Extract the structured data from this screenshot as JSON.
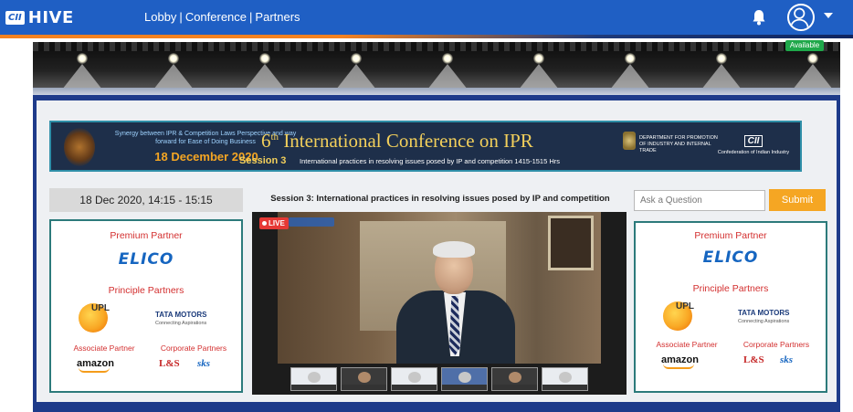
{
  "header": {
    "logo_cii": "CII",
    "logo_hive": "HIVE",
    "nav": [
      {
        "label": "Lobby"
      },
      {
        "label": "Conference"
      },
      {
        "label": "Partners"
      }
    ],
    "nav_separator": "|"
  },
  "stage": {
    "status": "Available"
  },
  "banner": {
    "subtitle": "Synergy between IPR & Competition Laws Perspective and way forward for Ease of Doing Business",
    "date": "18 December 2020",
    "title_number": "6",
    "title_suffix": "th",
    "title": "International Conference on IPR",
    "session": "Session 3",
    "description": "International practices in resolving issues posed by IP and competition 1415-1515 Hrs",
    "dept": "DEPARTMENT FOR PROMOTION OF INDUSTRY AND INTERNAL TRADE",
    "cii_mark": "CII",
    "cii_full": "Confederation of Indian Industry"
  },
  "left_panel": {
    "date_time": "18 Dec 2020, 14:15 - 15:15"
  },
  "partners": {
    "premium_heading": "Premium Partner",
    "premium_name": "ELICO",
    "principle_heading": "Principle Partners",
    "principle": [
      {
        "name": "UPL"
      },
      {
        "name": "TATA MOTORS",
        "tagline": "Connecting Aspirations"
      }
    ],
    "associate_heading": "Associate Partner",
    "associate_name": "amazon",
    "corporate_heading": "Corporate Partners",
    "corporate": [
      {
        "name": "L&S"
      },
      {
        "name": "sks"
      }
    ]
  },
  "session": {
    "title": "Session 3: International practices in resolving issues posed by IP and competition",
    "live_label": "LIVE"
  },
  "question": {
    "placeholder": "Ask a Question",
    "submit_label": "Submit"
  },
  "colors": {
    "header_bg": "#1f5fc4",
    "accent_orange": "#f5a623",
    "partner_heading": "#d32f2f",
    "frame": "#1e3b8a",
    "live": "#e53935"
  }
}
